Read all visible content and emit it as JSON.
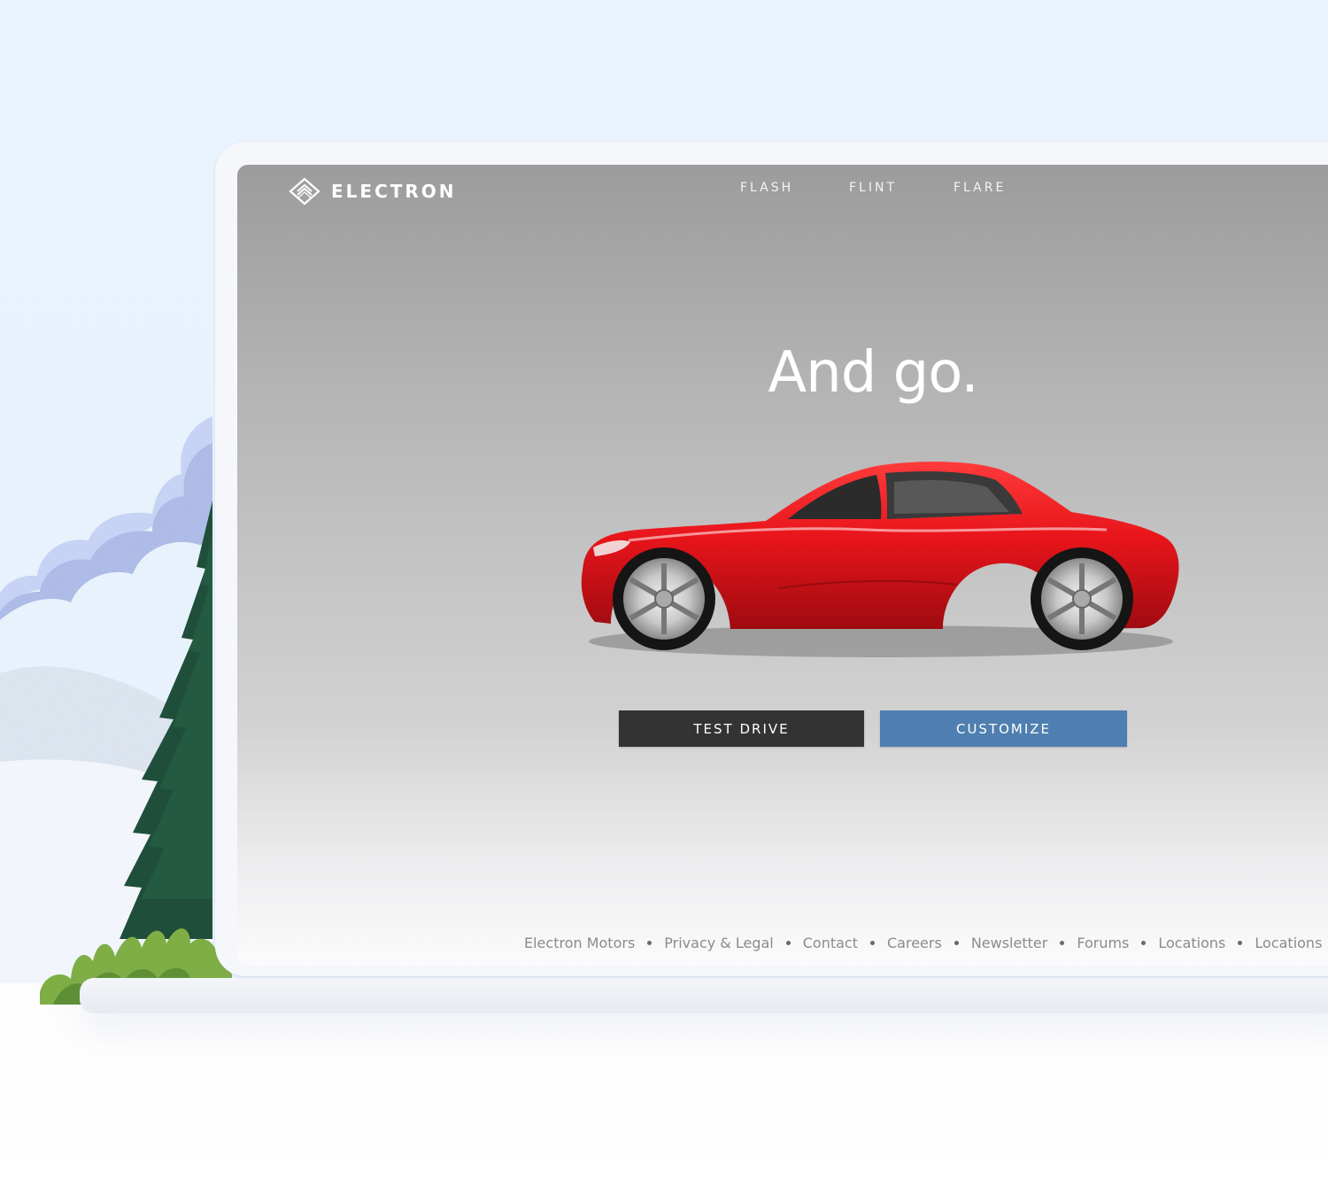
{
  "brand": {
    "name": "ELECTRON",
    "icon": "electron-logo-icon"
  },
  "nav": {
    "items": [
      "FLASH",
      "FLINT",
      "FLARE"
    ]
  },
  "hero": {
    "headline": "And go."
  },
  "buttons": {
    "test_drive": "TEST DRIVE",
    "customize": "CUSTOMIZE"
  },
  "footer": {
    "links": [
      "Electron Motors",
      "Privacy & Legal",
      "Contact",
      "Careers",
      "Newsletter",
      "Forums",
      "Locations",
      "Locations"
    ]
  },
  "colors": {
    "test_drive_bg": "#333333",
    "customize_bg": "#4e7fb0",
    "car_body": "#e8151b",
    "tree": "#1f4f3a",
    "sky": "#e9f3fd"
  }
}
